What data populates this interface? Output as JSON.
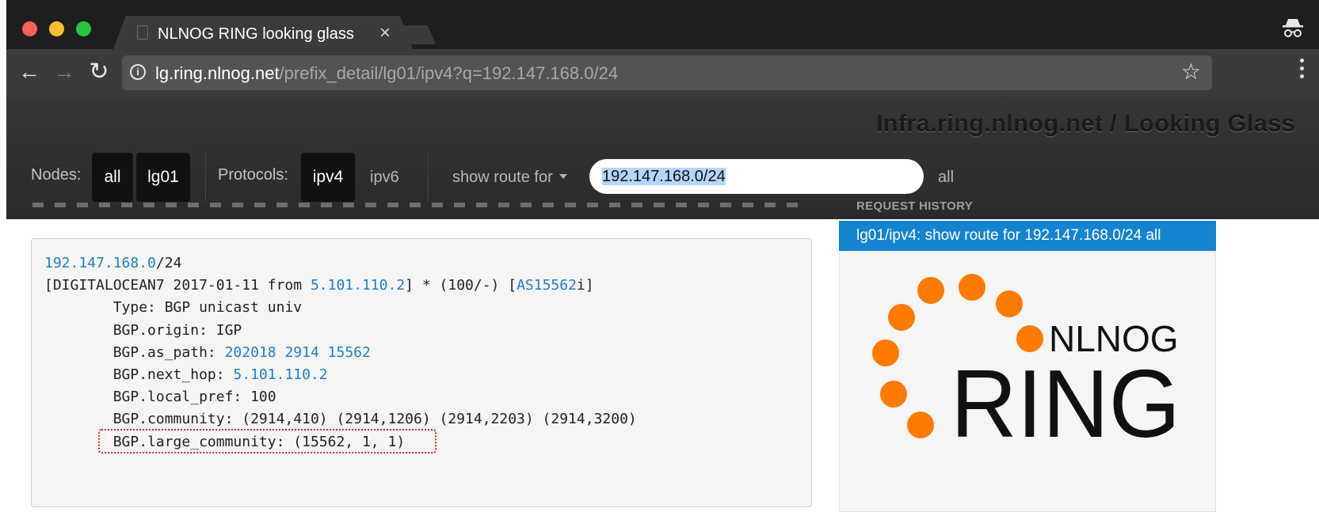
{
  "browser": {
    "tab_title": "NLNOG RING looking glass",
    "tab_close": "×",
    "url_host": "lg.ring.nlnog.net",
    "url_path": "/prefix_detail/lg01/ipv4?q=192.147.168.0/24",
    "back_icon": "←",
    "forward_icon": "→",
    "reload_icon": "↻",
    "star_icon": "☆"
  },
  "navbar": {
    "brand": "Infra.ring.nlnog.net / Looking Glass",
    "nodes_label": "Nodes:",
    "nodes": [
      "all",
      "lg01"
    ],
    "protocols_label": "Protocols:",
    "protocols": [
      "ipv4",
      "ipv6"
    ],
    "active_protocol": "ipv4",
    "command_select": "show route for",
    "query_value": "192.147.168.0/24",
    "query_suffix": "all"
  },
  "result": {
    "prefix_link": "192.147.168.0",
    "prefix_len": "/24",
    "line2_open": "[DIGITALOCEAN7 2017-01-11 from ",
    "line2_from_ip": "5.101.110.2",
    "line2_mid": "] * (100/-) [",
    "line2_as": "AS15562",
    "line2_close": "i]",
    "indent": "        ",
    "type": "Type: BGP unicast univ",
    "origin": "BGP.origin: IGP",
    "as_path_label": "BGP.as_path: ",
    "as_path": [
      "202018",
      "2914",
      "15562"
    ],
    "next_hop_label": "BGP.next_hop: ",
    "next_hop": "5.101.110.2",
    "local_pref": "BGP.local_pref: 100",
    "community": "BGP.community: (2914,410) (2914,1206) (2914,2203) (2914,3200)",
    "large_community": "BGP.large_community: (15562, 1, 1)"
  },
  "sidebar": {
    "history_heading": "REQUEST HISTORY",
    "history_items": [
      "lg01/ipv4: show route for 192.147.168.0/24 all"
    ],
    "logo_text_top": "NLNOG",
    "logo_text_bottom": "RING",
    "logo_color": "#ff7a00"
  },
  "colors": {
    "link": "#1f7fc4",
    "history_active": "#1483d0",
    "highlight_border": "#e0282b"
  }
}
